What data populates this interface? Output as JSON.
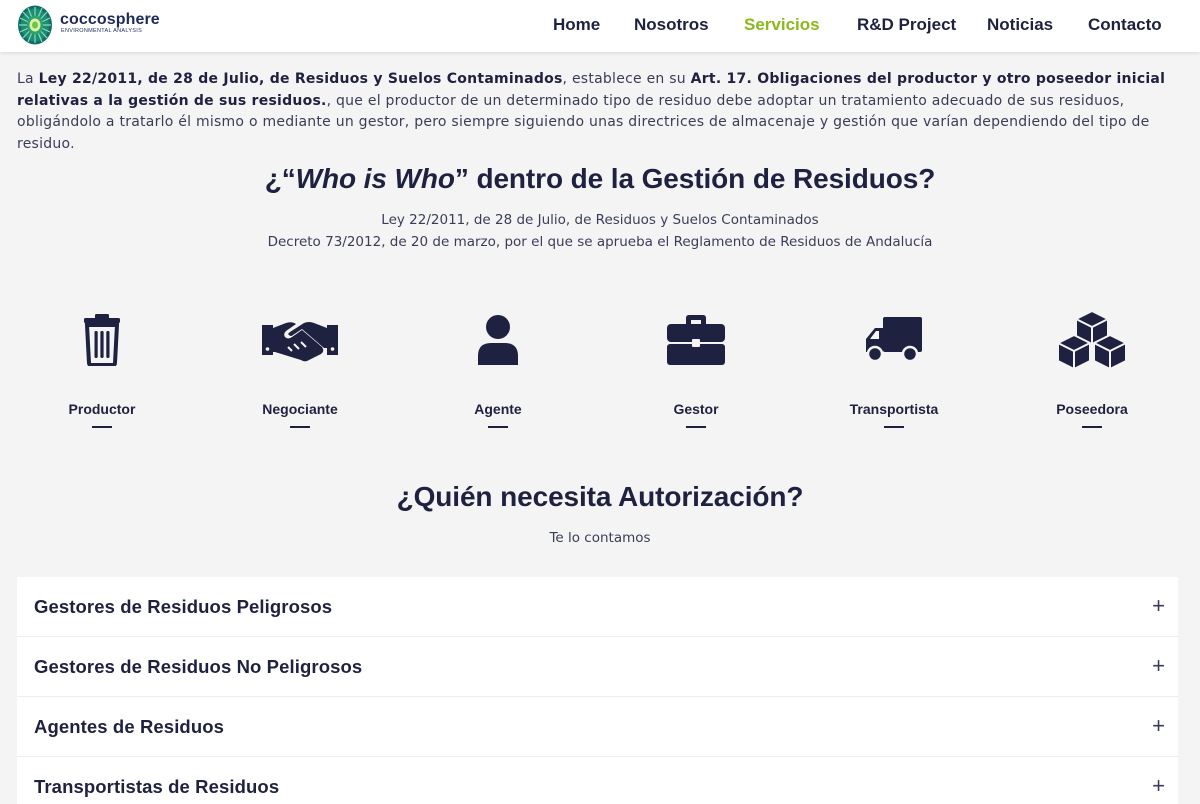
{
  "brand": {
    "name": "coccosphere",
    "tagline": "ENVIRONMENTAL ANALYSIS",
    "colors": {
      "navy": "#1e2140",
      "accent": "#8bb81a",
      "background": "#f4f4f4"
    }
  },
  "nav": {
    "items": [
      {
        "label": "Home"
      },
      {
        "label": "Nosotros"
      },
      {
        "label": "Servicios",
        "active": true
      },
      {
        "label": "R&D Project"
      },
      {
        "label": "Noticias"
      },
      {
        "label": "Contacto"
      }
    ]
  },
  "intro": {
    "p1": "La ",
    "law": "Ley 22/2011, de 28 de Julio, de Residuos y Suelos Contaminados",
    "p2": ", establece en su ",
    "article": "Art. 17. Obligaciones del productor y otro poseedor inicial relativas a la gestión de sus residuos.",
    "p3": ", que el productor de un determinado tipo de residuo debe adoptar un tratamiento adecuado de sus residuos, obligándolo a tratarlo él mismo o mediante un gestor, pero siempre siguiendo unas directrices de almacenaje y gestión que varían dependiendo del tipo de residuo."
  },
  "who": {
    "title_start": "¿“",
    "title_italic": "Who is Who",
    "title_end": "” dentro de la Gestión de Residuos?",
    "line1": "Ley 22/2011, de 28 de Julio, de Residuos y Suelos Contaminados",
    "line2": "Decreto 73/2012, de 20 de marzo, por el que se aprueba el Reglamento de Residuos de Andalucía"
  },
  "roles": [
    {
      "label": "Productor",
      "icon": "trash-icon"
    },
    {
      "label": "Negociante",
      "icon": "handshake-icon"
    },
    {
      "label": "Agente",
      "icon": "user-icon"
    },
    {
      "label": "Gestor",
      "icon": "briefcase-icon"
    },
    {
      "label": "Transportista",
      "icon": "truck-icon"
    },
    {
      "label": "Poseedora",
      "icon": "cubes-icon"
    }
  ],
  "authorization": {
    "title": "¿Quién necesita Autorización?",
    "subtitle": "Te lo contamos"
  },
  "accordion": {
    "expand_symbol": "+",
    "items": [
      {
        "title": "Gestores de Residuos Peligrosos"
      },
      {
        "title": "Gestores de Residuos No Peligrosos"
      },
      {
        "title": "Agentes de Residuos"
      },
      {
        "title": "Transportistas de Residuos"
      }
    ]
  }
}
